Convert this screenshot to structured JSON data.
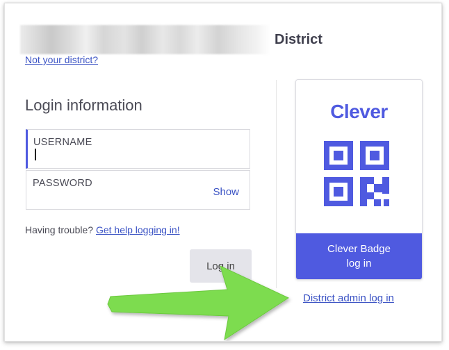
{
  "district": {
    "name_suffix": "District",
    "not_your_district": "Not your district?"
  },
  "login": {
    "heading": "Login information",
    "username_label": "USERNAME",
    "password_label": "PASSWORD",
    "show_label": "Show",
    "trouble_text": "Having trouble?",
    "help_link": "Get help logging in!",
    "login_button": "Log in"
  },
  "badge": {
    "logo_text": "Clever",
    "button_line1": "Clever Badge",
    "button_line2": "log in",
    "admin_link": "District admin log in"
  },
  "colors": {
    "accent": "#4f5ae0",
    "link": "#3a52c4",
    "arrow": "#7ddc4f"
  }
}
